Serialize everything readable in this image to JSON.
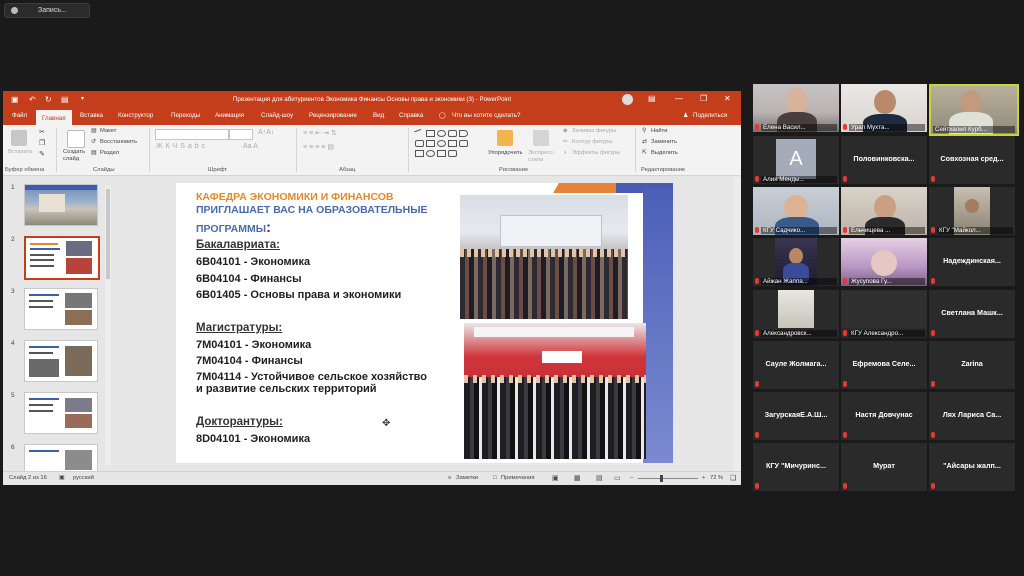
{
  "recording": {
    "label": "Запись..."
  },
  "ppt": {
    "title": "Презентация для абитуриентов Экономика Финансы Основы права и экономики (3) - PowerPoint",
    "tabs": [
      "Файл",
      "Главная",
      "Вставка",
      "Конструктор",
      "Переходы",
      "Анимация",
      "Слайд-шоу",
      "Рецензирование",
      "Вид",
      "Справка"
    ],
    "tell_me": "Что вы хотите сделать?",
    "share": "Поделиться",
    "ribbon": {
      "paste": "Вставить",
      "clipboard_group": "Буфер обмена",
      "create_slide": "Создать слайд",
      "layout": "Макет",
      "reset": "Восстановить",
      "section": "Раздел",
      "slides_group": "Слайды",
      "font_group": "Шрифт",
      "paragraph_group": "Абзац",
      "arrange": "Упорядочить",
      "quick_styles": "Экспресс-стили",
      "shape_fill": "Заливка фигуры",
      "shape_outline": "Контур фигуры",
      "shape_effects": "Эффекты фигуры",
      "drawing_group": "Рисование",
      "find": "Найти",
      "replace": "Заменить",
      "select": "Выделить",
      "editing_group": "Редактирование"
    },
    "thumbnail_numbers": [
      "1",
      "2",
      "3",
      "4",
      "5",
      "6"
    ],
    "slide": {
      "heading_line1": "КАФЕДРА ЭКОНОМИКИ И ФИНАНСОВ",
      "heading_line2": "ПРИГЛАШАЕТ ВАС НА ОБРАЗОВАТЕЛЬНЫЕ",
      "heading_line3": "ПРОГРАММЫ",
      "heading_colon": ":",
      "bachelor_label": "Бакалавриата:",
      "bachelor_items": [
        "6В04101 - Экономика",
        "6В04104 - Финансы",
        "6В01405 - Основы права и экономики"
      ],
      "master_label": "Магистратуры:",
      "master_items": [
        "7М04101 - Экономика",
        "7М04104 - Финансы",
        "7М04114 - Устойчивое сельское хозяйство",
        "и развитие сельских территорий"
      ],
      "doctor_label": "Докторантуры:",
      "doctor_items": [
        "8D04101 - Экономика"
      ]
    },
    "status": {
      "slide_of": "Слайд 2 из 16",
      "language": "русский",
      "notes": "Заметки",
      "comments": "Примечания",
      "zoom": "72 %"
    }
  },
  "participants": [
    {
      "name": "Елена Васил...",
      "video": true
    },
    {
      "name": "Урал Мухта...",
      "video": true
    },
    {
      "name": "Сейтхалил Курб...",
      "video": true,
      "active": true
    },
    {
      "name": "Алия Менды...",
      "video": false,
      "avatar_letter": "А"
    },
    {
      "name": "Половинковска...",
      "video": false
    },
    {
      "name": "Совхозная сред...",
      "video": false
    },
    {
      "name": "КГУ Садчико...",
      "video": true
    },
    {
      "name": "Ельчищева ...",
      "video": true
    },
    {
      "name": "КГУ \"Майкол...",
      "video": true
    },
    {
      "name": "Айжан Жаппа...",
      "video": true
    },
    {
      "name": "Жусупова Гу...",
      "video": true
    },
    {
      "name": "Надеждинская...",
      "video": false
    },
    {
      "name": "Александровск...",
      "video": true
    },
    {
      "name": "КГУ Александро...",
      "video": true
    },
    {
      "name": "Светлана Машк...",
      "video": false
    },
    {
      "name": "Сауле Жолмага...",
      "video": false
    },
    {
      "name": "Ефремова Селе...",
      "video": false
    },
    {
      "name": "Zarina",
      "video": false
    },
    {
      "name": "ЗагурскаяЕ.А.Ш...",
      "video": false
    },
    {
      "name": "Настя Довчунас",
      "video": false
    },
    {
      "name": "Лях Лариса Са...",
      "video": false
    },
    {
      "name": "КГУ \"Мичуринс...",
      "video": false
    },
    {
      "name": "Мурат",
      "video": false
    },
    {
      "name": "\"Айсары жалп...",
      "video": false
    }
  ],
  "colors": {
    "ppt_accent": "#c43e1c",
    "active_speaker": "#c9d43a",
    "heading_orange": "#e3892b",
    "heading_blue": "#4a6aa8"
  }
}
